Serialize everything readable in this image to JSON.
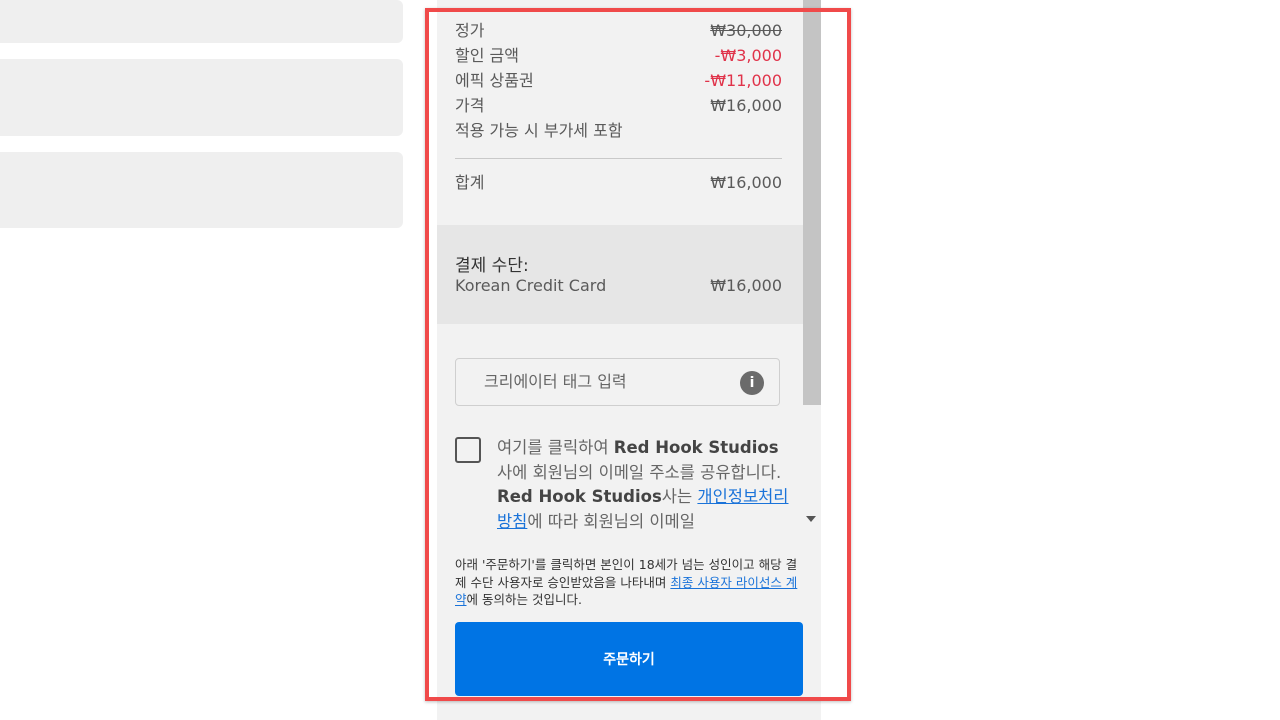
{
  "summary": {
    "list_price_label": "정가",
    "list_price_value": "₩30,000",
    "discount_label": "할인 금액",
    "discount_value": "-₩3,000",
    "voucher_label": "에픽 상품권",
    "voucher_value": "-₩11,000",
    "price_label": "가격",
    "price_value": "₩16,000",
    "vat_note": "적용 가능 시 부가세 포함",
    "total_label": "합계",
    "total_value": "₩16,000"
  },
  "payment": {
    "title": "결제 수단:",
    "method_label": "Korean Credit Card",
    "method_value": "₩16,000"
  },
  "creator_tag": {
    "placeholder": "크리에이터 태그 입력",
    "info_icon_glyph": "i"
  },
  "consent": {
    "part1": "여기를 클릭하여 ",
    "company1": "Red Hook Studios",
    "part2": "사에 회원님의 이메일 주소를 공유합니다. ",
    "company2": "Red Hook Studios",
    "part3": "사는 ",
    "privacy_link": "개인정보처리방침",
    "part4": "에 따라 회원님의 이메일"
  },
  "legal": {
    "text_before": "아래 '주문하기'를 클릭하면 본인이 18세가 넘는 성인이고 해당 결제 수단 사용자로 승인받았음을 나타내며 ",
    "eula_link": "최종 사용자 라이선스 계약",
    "text_after": "에 동의하는 것입니다."
  },
  "order_button_label": "주문하기",
  "colors": {
    "accent": "#0074e4",
    "discount": "#e0334a",
    "highlight_border": "#f04a4a"
  }
}
